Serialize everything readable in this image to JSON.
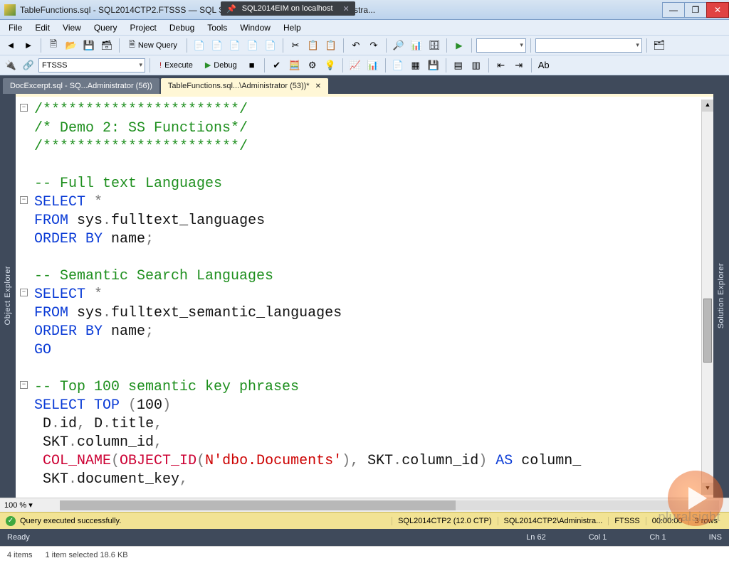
{
  "title": "TableFunctions.sql - SQL2014CTP2.FTSSS — SQL Server Management Studio (Administra...",
  "mini_tab": "SQL2014EIM on localhost",
  "win": {
    "min": "—",
    "max": "❐",
    "close": "✕"
  },
  "menu": [
    "File",
    "Edit",
    "View",
    "Query",
    "Project",
    "Debug",
    "Tools",
    "Window",
    "Help"
  ],
  "toolbar1": {
    "new_query": "New Query"
  },
  "toolbar2": {
    "db_combo": "FTSSS",
    "execute": "Execute",
    "debug": "Debug"
  },
  "tabs": [
    {
      "label": "DocExcerpt.sql - SQ...Administrator (56))",
      "active": false
    },
    {
      "label": "TableFunctions.sql...\\Administrator (53))*",
      "active": true
    }
  ],
  "side": {
    "left": "Object Explorer",
    "right": "Solution Explorer"
  },
  "code": {
    "l1": "/***********************/",
    "l2": "/* Demo 2: SS Functions*/",
    "l3": "/***********************/",
    "l4": "",
    "l5": "-- Full text Languages",
    "l6a": "SELECT",
    "l6b": " *",
    "l7a": "FROM",
    "l7b": " sys",
    "l7c": ".",
    "l7d": "fulltext_languages",
    "l8a": "ORDER BY",
    "l8b": " name",
    "l8c": ";",
    "l9": "",
    "l10": "-- Semantic Search Languages",
    "l11a": "SELECT",
    "l11b": " *",
    "l12a": "FROM",
    "l12b": " sys",
    "l12c": ".",
    "l12d": "fulltext_semantic_languages",
    "l13a": "ORDER BY",
    "l13b": " name",
    "l13c": ";",
    "l14": "GO",
    "l15": "",
    "l16": "-- Top 100 semantic key phrases",
    "l17a": "SELECT TOP ",
    "l17b": "(",
    "l17c": "100",
    "l17d": ")",
    "l18a": " D",
    "l18b": ".",
    "l18c": "id",
    "l18d": ",",
    "l18e": " D",
    "l18f": ".",
    "l18g": "title",
    "l18h": ",",
    "l19a": " SKT",
    "l19b": ".",
    "l19c": "column_id",
    "l19d": ",",
    "l20a": " ",
    "l20b": "COL_NAME",
    "l20c": "(",
    "l20d": "OBJECT_ID",
    "l20e": "(",
    "l20f": "N'dbo.Documents'",
    "l20g": ")",
    "l20h": ",",
    "l20i": " SKT",
    "l20j": ".",
    "l20k": "column_id",
    "l20l": ")",
    "l20m": " AS",
    "l20n": " column_",
    "l21a": " SKT",
    "l21b": ".",
    "l21c": "document_key",
    "l21d": ","
  },
  "zoom": "100 %",
  "qstatus": {
    "msg": "Query executed successfully.",
    "server": "SQL2014CTP2 (12.0 CTP)",
    "conn": "SQL2014CTP2\\Administra...",
    "db": "FTSSS",
    "time": "00:00:00",
    "rows": "3 rows"
  },
  "idestatus": {
    "ready": "Ready",
    "ln": "Ln 62",
    "col": "Col 1",
    "ch": "Ch 1",
    "mode": "INS"
  },
  "explorerbar": {
    "items": "4 items",
    "sel": "1 item selected  18.6 KB"
  },
  "watermark": "pluralsight"
}
